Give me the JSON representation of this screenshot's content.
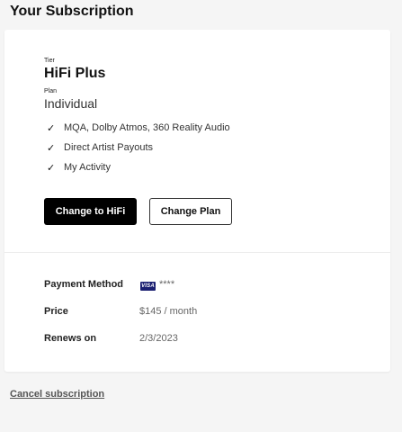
{
  "page": {
    "title": "Your Subscription"
  },
  "subscription": {
    "tier_label": "Tier",
    "tier": "HiFi Plus",
    "plan_label": "Plan",
    "plan": "Individual",
    "features": [
      {
        "check_icon": "✓",
        "text": "MQA, Dolby Atmos, 360 Reality Audio"
      },
      {
        "check_icon": "✓",
        "text": "Direct Artist Payouts"
      },
      {
        "check_icon": "✓",
        "text": "My Activity"
      }
    ],
    "primary_button": "Change to HiFi",
    "secondary_button": "Change Plan"
  },
  "billing": {
    "payment_label": "Payment Method",
    "card_brand": "VISA",
    "card_masked": "****",
    "price_label": "Price",
    "price": "$145 / month",
    "renews_label": "Renews on",
    "renews": "2/3/2023"
  },
  "footer": {
    "cancel_link": "Cancel subscription"
  },
  "colors": {
    "primary_button_bg": "#000000",
    "visa_blue": "#1a1f71",
    "page_bg": "#f5f5f5"
  }
}
